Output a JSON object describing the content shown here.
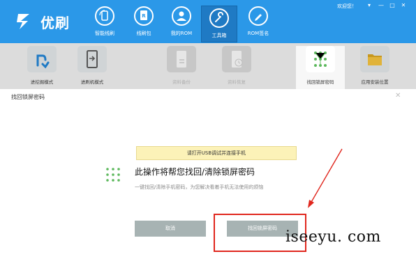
{
  "app": {
    "name": "优刷"
  },
  "nav": [
    {
      "label": "智能线刷",
      "icon": "phone-refresh-icon"
    },
    {
      "label": "线刷包",
      "icon": "rom-file-icon"
    },
    {
      "label": "我的ROM",
      "icon": "user-icon"
    },
    {
      "label": "工具箱",
      "icon": "wrench-icon",
      "active": true
    },
    {
      "label": "ROM签名",
      "icon": "pen-icon"
    }
  ],
  "header": {
    "welcome": "欢迎您！"
  },
  "tools": [
    {
      "label": "进挖掘模式",
      "icon": "dig-icon",
      "state": "normal"
    },
    {
      "label": "进刷机模式",
      "icon": "flash-mode-icon",
      "state": "normal"
    },
    {
      "label": "资料备份",
      "icon": "backup-icon",
      "state": "dim"
    },
    {
      "label": "资料恢复",
      "icon": "restore-icon",
      "state": "dim"
    },
    {
      "label": "找回锁屏密码",
      "icon": "pattern-lock-icon",
      "state": "active"
    },
    {
      "label": "应用安装位置",
      "icon": "folder-icon",
      "state": "normal"
    }
  ],
  "dialog": {
    "title": "找回锁屏密码",
    "notice": "请打开USB调试并连接手机",
    "heading": "此操作将帮您找回/清除锁屏密码",
    "description": "一键找回/清除手机密码，为您解决看着手机无法使用的烦恼",
    "cancel_label": "取消",
    "retrieve_label": "找回锁屏密码"
  },
  "watermark": "iseeyu. com",
  "colors": {
    "primary": "#2b98e8",
    "highlight": "#e0261d",
    "notice_bg": "#fcf2b8",
    "button_bg": "#a7b3b3"
  }
}
